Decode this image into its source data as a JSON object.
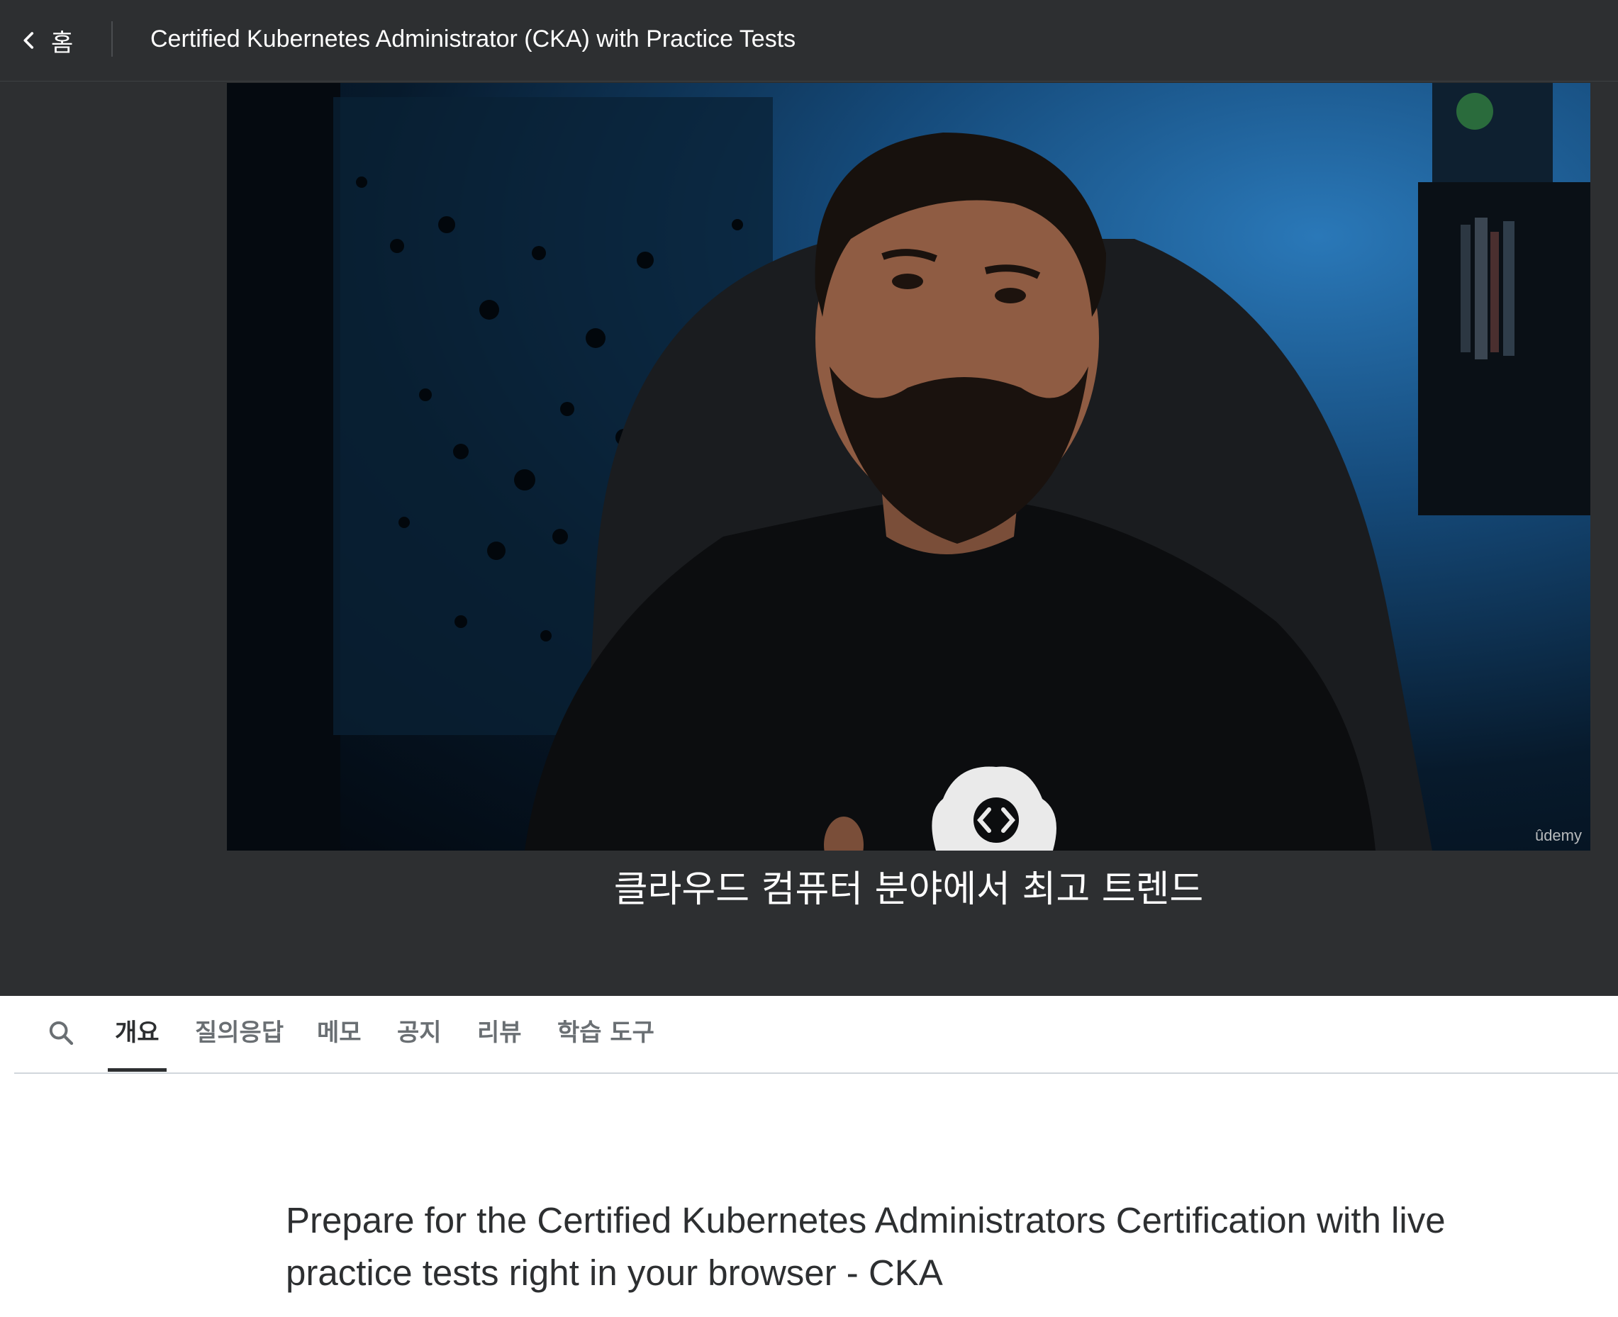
{
  "header": {
    "back_label": "홈",
    "course_title": "Certified Kubernetes Administrator (CKA) with Practice Tests"
  },
  "video": {
    "caption": "클라우드 컴퓨터 분야에서 최고 트렌드",
    "watermark": "ûdemy"
  },
  "tabs": [
    {
      "label": "개요",
      "active": true
    },
    {
      "label": "질의응답",
      "active": false
    },
    {
      "label": "메모",
      "active": false
    },
    {
      "label": "공지",
      "active": false
    },
    {
      "label": "리뷰",
      "active": false
    },
    {
      "label": "학습 도구",
      "active": false
    }
  ],
  "overview": {
    "headline": "Prepare for the Certified Kubernetes Administrators Certification with live practice tests right in your browser - CKA"
  },
  "colors": {
    "header_bg": "#2d2f31",
    "text_dark": "#2d2f31",
    "text_muted": "#6a6f73",
    "divider": "#d1d7dc"
  },
  "icons": {
    "back": "chevron-left-icon",
    "search": "search-icon"
  }
}
